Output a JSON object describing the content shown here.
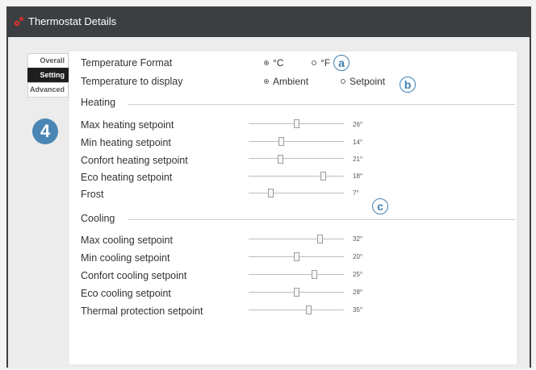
{
  "window": {
    "title": "Thermostat Details"
  },
  "tabs": [
    {
      "label": "Overall",
      "active": false
    },
    {
      "label": "Setting",
      "active": true
    },
    {
      "label": "Advanced",
      "active": false
    }
  ],
  "step_badge": "4",
  "callouts": {
    "a": "a",
    "b": "b",
    "c": "c"
  },
  "format": {
    "label": "Temperature Format",
    "options": [
      {
        "label": "°C",
        "selected": true
      },
      {
        "label": "°F",
        "selected": false
      }
    ]
  },
  "display": {
    "label": "Temperature to display",
    "options": [
      {
        "label": "Ambient",
        "selected": true
      },
      {
        "label": "Setpoint",
        "selected": false
      }
    ]
  },
  "heating": {
    "title": "Heating",
    "rows": [
      {
        "label": "Max heating setpoint",
        "value": "26°",
        "level": 0.5
      },
      {
        "label": "Min heating setpoint",
        "value": "14°",
        "level": 0.33
      },
      {
        "label": "Confort heating setpoint",
        "value": "21°",
        "level": 0.32
      },
      {
        "label": "Eco heating setpoint",
        "value": "18°",
        "level": 0.8
      },
      {
        "label": "Frost",
        "value": "7°",
        "level": 0.22
      }
    ]
  },
  "cooling": {
    "title": "Cooling",
    "rows": [
      {
        "label": "Max cooling setpoint",
        "value": "32°",
        "level": 0.77
      },
      {
        "label": "Min cooling setpoint",
        "value": "20°",
        "level": 0.5
      },
      {
        "label": "Confort cooling setpoint",
        "value": "25°",
        "level": 0.7
      },
      {
        "label": "Eco cooling setpoint",
        "value": "28°",
        "level": 0.5
      },
      {
        "label": "Thermal protection setpoint",
        "value": "35°",
        "level": 0.64
      }
    ]
  },
  "colors": {
    "accent": "#3d80b3",
    "titlebar": "#3b3f42",
    "badge": "#4a86b4"
  }
}
